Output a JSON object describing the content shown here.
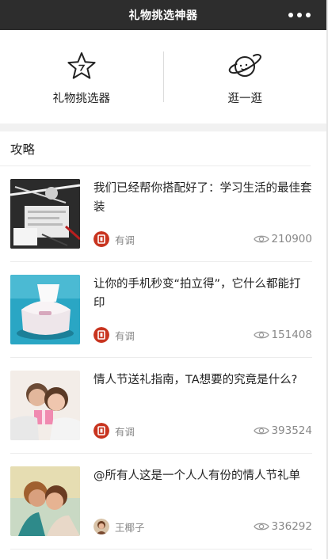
{
  "topbar": {
    "title": "礼物挑选神器"
  },
  "actions": [
    {
      "label": "礼物挑选器",
      "icon": "star-icon"
    },
    {
      "label": "逛一逛",
      "icon": "planet-icon"
    }
  ],
  "section": {
    "title": "攻略"
  },
  "articles": [
    {
      "title": "我们已经帮你搭配好了：学习生活的最佳套装",
      "author": "有调",
      "views": "210900",
      "thumb": "stationery-photo",
      "avatar": "youdiao-logo"
    },
    {
      "title": "让你的手机秒变“拍立得”，它什么都能打印",
      "author": "有调",
      "views": "151408",
      "thumb": "mini-printer-photo",
      "avatar": "youdiao-logo"
    },
    {
      "title": "情人节送礼指南，TA想要的究竟是什么?",
      "author": "有调",
      "views": "393524",
      "thumb": "couple-gift-photo",
      "avatar": "youdiao-logo"
    },
    {
      "title": "@所有人这是一个人人有份的情人节礼单",
      "author": "王椰子",
      "views": "336292",
      "thumb": "couple-kiss-photo",
      "avatar": "user-avatar"
    }
  ],
  "colors": {
    "topbar": "#2d2d2d",
    "brand_red": "#c8341f",
    "muted": "#888888"
  }
}
